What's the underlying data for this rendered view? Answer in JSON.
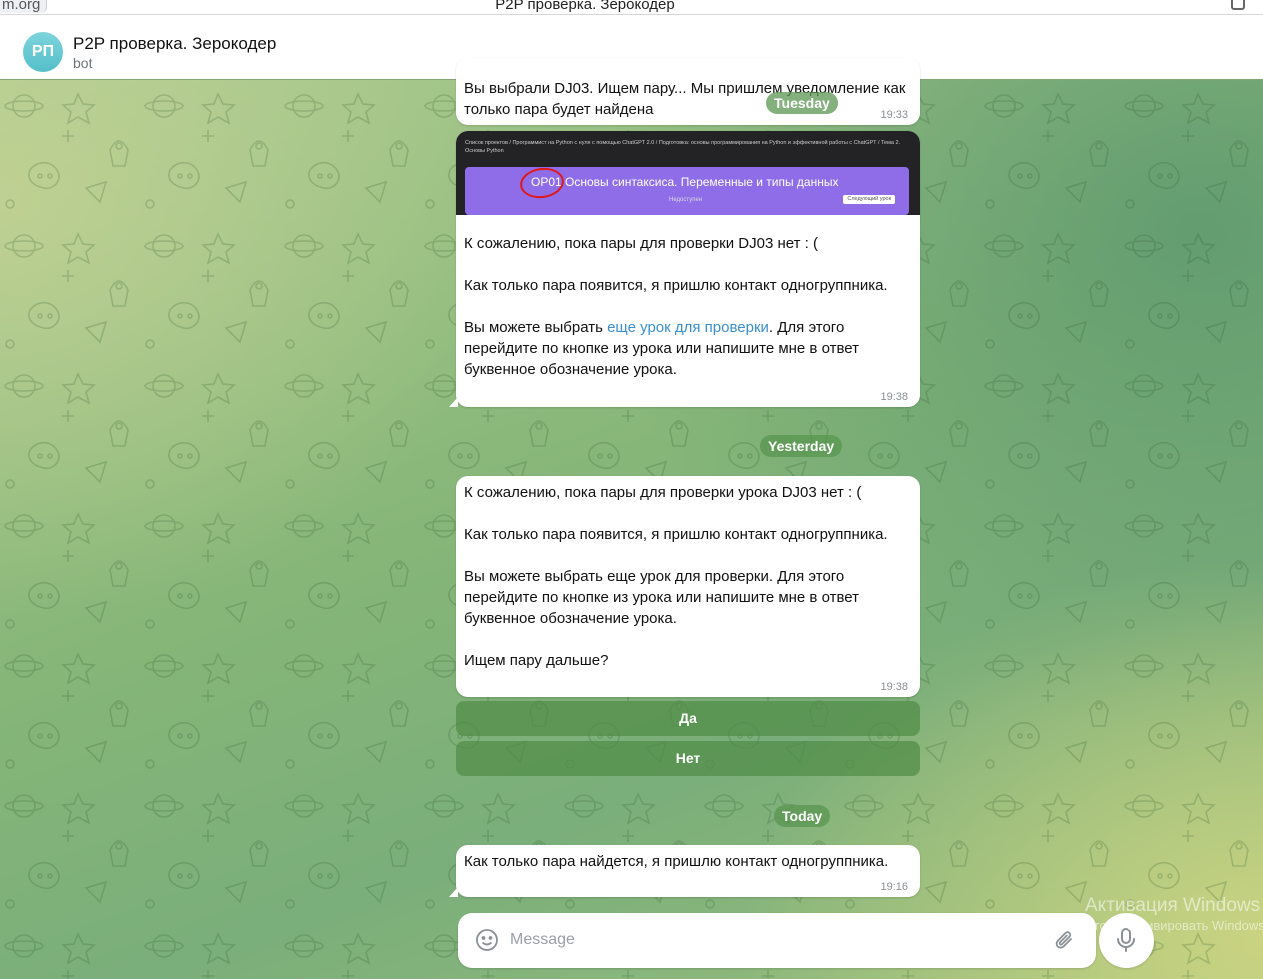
{
  "browser": {
    "url_fragment": "m.org",
    "window_title": "P2P проверка. Зерокодер"
  },
  "header": {
    "avatar_initials": "РП",
    "title": "P2P проверка. Зерокодер",
    "subtitle": "bot"
  },
  "messages": [
    {
      "text": "Вы выбрали DJ03. Ищем пару... Мы пришлем уведомление как только пара будет найдена",
      "time": "19:33"
    },
    {
      "screenshot": {
        "breadcrumb": "Список проектов / Программист на Python с нуля с помощью ChatGPT 2.0 / Подготовка: основы программирования на Python и эффективной работы с ChatGPT / Тема 2. Основы Python",
        "heading": "OP01 Основы синтаксиса. Переменные и типы данных",
        "status": "Недоступен",
        "next_button": "Следующий урок"
      },
      "text_part1": "К сожалению, пока пары для проверки DJ03 нет : (\n\nКак только пара появится, я пришлю контакт одногруппника.\n\nВы можете выбрать ",
      "link": "еще урок для проверки",
      "text_part2": ". Для этого перейдите по кнопке из урока или напишите мне в ответ буквенное обозначение урока.",
      "time": "19:38"
    },
    {
      "text": "К сожалению, пока пары для проверки урока DJ03 нет : (\n\nКак только пара появится, я пришлю контакт одногруппника.\n\nВы можете выбрать еще урок для проверки. Для этого перейдите по кнопке из урока или напишите мне в ответ буквенное обозначение урока.\n\nИщем пару дальше?",
      "time": "19:38",
      "buttons": [
        "Да",
        "Нет"
      ]
    },
    {
      "text": "Как только пара найдется, я пришлю контакт одногруппника.",
      "time": "19:16"
    }
  ],
  "date_separators": [
    "Tuesday",
    "Yesterday",
    "Today"
  ],
  "composer": {
    "placeholder": "Message",
    "emoji_icon": "smile-icon",
    "attach_icon": "paperclip-icon",
    "mic_icon": "microphone-icon"
  },
  "watermark": {
    "line1": "Активация Windows",
    "line2": "Чтобы активировать Windows"
  },
  "colors": {
    "accent_link": "#3a8fd0",
    "date_pill": "#5a9650",
    "keyboard_button": "#508c46",
    "avatar": "#6ccbd4"
  }
}
